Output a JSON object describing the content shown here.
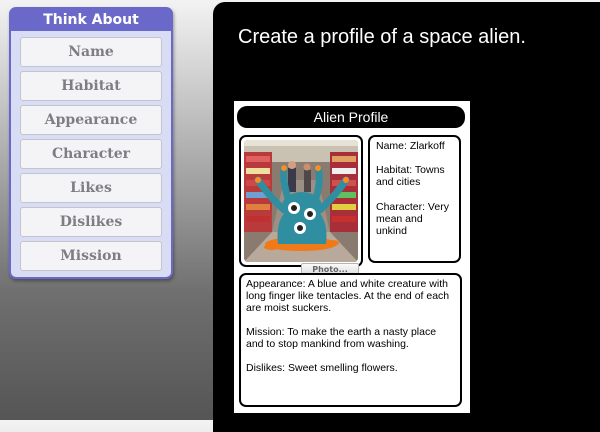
{
  "think_about": {
    "header": "Think About",
    "items": [
      "Name",
      "Habitat",
      "Appearance",
      "Character",
      "Likes",
      "Dislikes",
      "Mission"
    ]
  },
  "instruction": "Create a profile of a space alien.",
  "profile": {
    "title": "Alien Profile",
    "photo_button": "Photo...",
    "name": "Name: Zlarkoff",
    "habitat": "Habitat: Towns and cities",
    "character": "Character: Very mean and unkind",
    "appearance": "Appearance:  A blue and white creature with long finger like tentacles. At the end of each are moist suckers.",
    "mission": "Mission: To make the earth a nasty place and to stop mankind from washing.",
    "dislikes": "Dislikes: Sweet smelling flowers."
  },
  "colors": {
    "panel_accent": "#6a68c8",
    "alien_body": "#2f8fa0",
    "splat": "#f07a18"
  },
  "icons": {
    "alien": "alien-illustration"
  }
}
